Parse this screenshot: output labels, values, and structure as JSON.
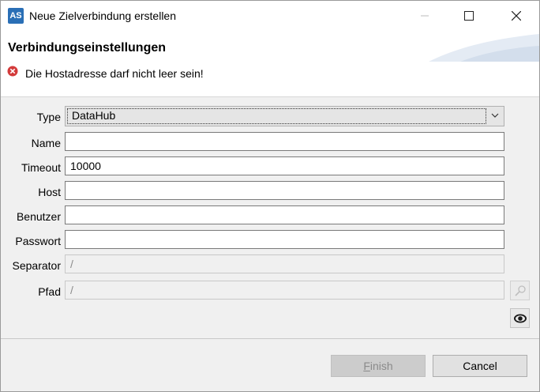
{
  "window": {
    "logo_text": "AS",
    "title": "Neue Zielverbindung erstellen"
  },
  "banner": {
    "title": "Verbindungseinstellungen",
    "error": "Die Hostadresse darf nicht leer sein!"
  },
  "form": {
    "type": {
      "label": "Type",
      "value": "DataHub"
    },
    "name": {
      "label": "Name",
      "value": ""
    },
    "timeout": {
      "label": "Timeout",
      "value": "10000"
    },
    "host": {
      "label": "Host",
      "value": ""
    },
    "user": {
      "label": "Benutzer",
      "value": ""
    },
    "password": {
      "label": "Passwort",
      "value": ""
    },
    "separator": {
      "label": "Separator",
      "value": "/"
    },
    "path": {
      "label": "Pfad",
      "value": "/"
    }
  },
  "buttons": {
    "finish_mnemonic": "F",
    "finish_rest": "inish",
    "cancel": "Cancel"
  },
  "icons": {
    "error": "error-circle-icon",
    "browse": "magnifier-icon",
    "preview": "eye-icon"
  },
  "colors": {
    "error_red": "#d33a3a",
    "logo_blue": "#2a6fb6"
  }
}
